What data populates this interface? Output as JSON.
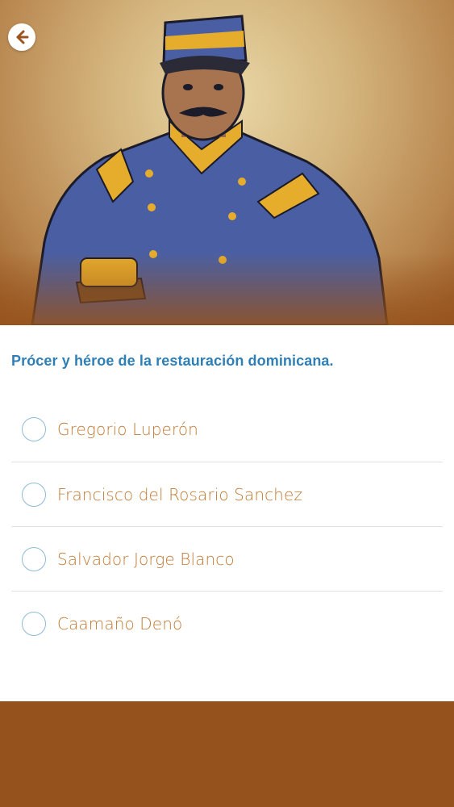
{
  "header": {
    "back_icon": "arrow-left-circle-icon",
    "illustration": "portrait of a Dominican general in blue uniform with gold cap"
  },
  "quiz": {
    "question": "Prócer y héroe de la restauración dominicana.",
    "options": [
      {
        "label": "Gregorio Luperón"
      },
      {
        "label": "Francisco del Rosario Sanchez"
      },
      {
        "label": "Salvador Jorge Blanco"
      },
      {
        "label": "Caamaño Denó"
      }
    ]
  },
  "colors": {
    "question_text": "#2f7fb7",
    "option_text": "#c27a34",
    "radio_border": "#8fb9d8",
    "footer": "#96521c",
    "divider": "#e1e1e1"
  }
}
